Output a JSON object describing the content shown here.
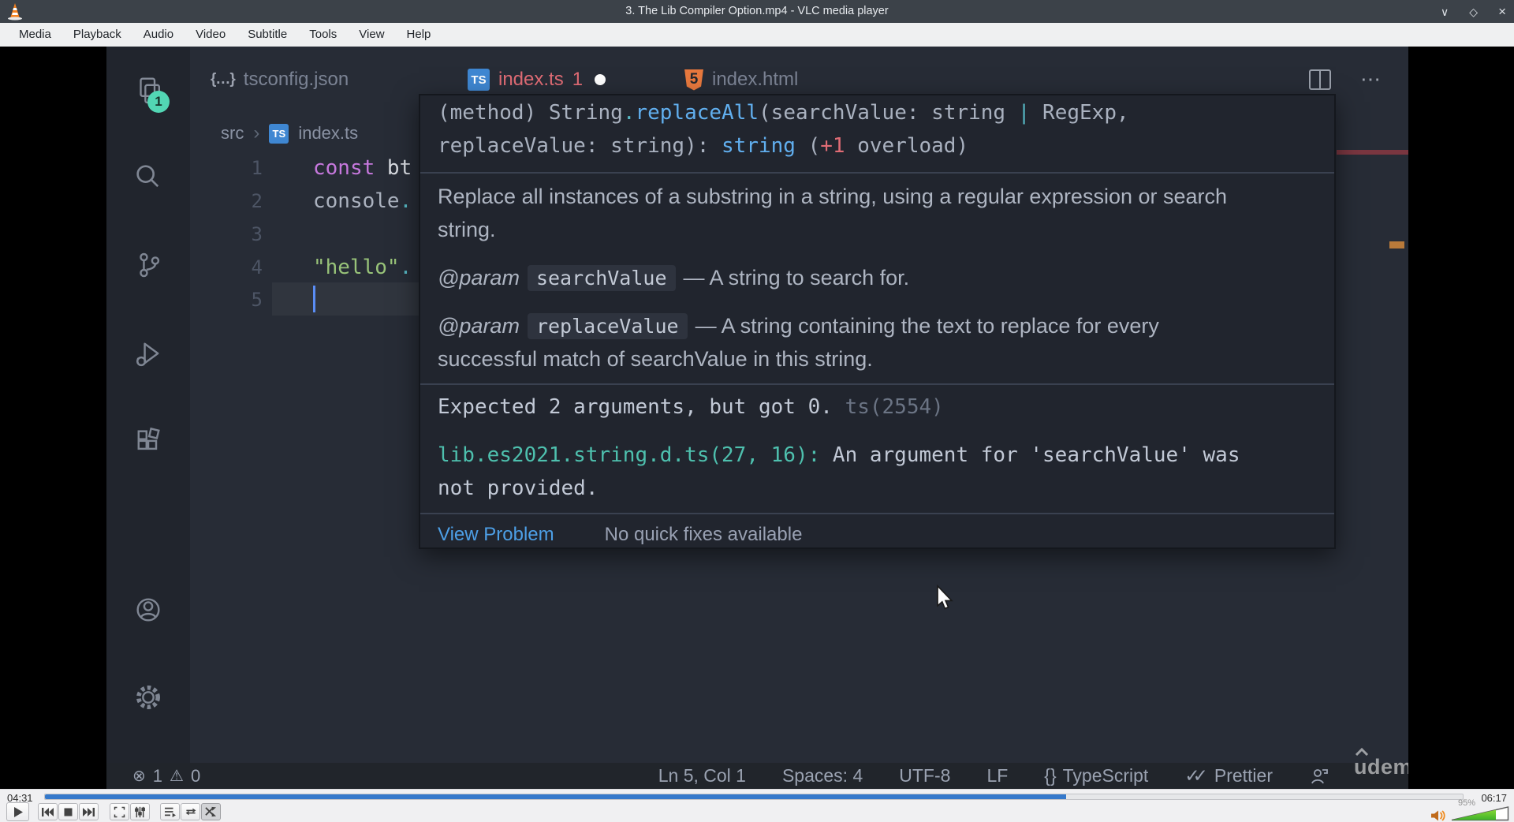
{
  "colors": {
    "titlebar_bg": "#3c4249",
    "menubar_bg": "#eff0f1",
    "editor_bg": "#272c36",
    "activitybar_bg": "#21252d",
    "tooltip_bg": "#21252e",
    "statusbar_bg": "#21252b",
    "accent_blue": "#61afef",
    "cyan": "#56b6c2",
    "keyword_purple": "#c678dd",
    "string_green": "#98c379",
    "error_red": "#e06c75",
    "source_path_teal": "#4ec0ae",
    "explorer_badge_teal": "#52d6b4",
    "ts_icon_blue": "#3f87d2",
    "html_icon_orange": "#e8793e",
    "seek_blue": "#3579cb",
    "volume_green": "#5ec42e"
  },
  "titlebar": {
    "title": "3. The Lib Compiler Option.mp4 - VLC media player",
    "minimize": "∨",
    "maximize": "◇",
    "close": "×"
  },
  "menu": [
    "Media",
    "Playback",
    "Audio",
    "Video",
    "Subtitle",
    "Tools",
    "View",
    "Help"
  ],
  "activity": {
    "explorer_badge": "1"
  },
  "tabs": {
    "json_icon": "{…}",
    "tab1": "tsconfig.json",
    "ts_icon": "TS",
    "tab2": "index.ts",
    "tab2_badge": "1",
    "html_icon": "5",
    "tab3": "index.html",
    "more_actions": "⋯"
  },
  "breadcrumb": {
    "folder": "src",
    "sep": "›",
    "file_icon": "TS",
    "file": "index.ts"
  },
  "code": {
    "line_numbers": [
      "1",
      "2",
      "3",
      "4",
      "5"
    ],
    "l1_keyword": "const",
    "l1_text": " bt",
    "l2_text": "console",
    "l2_accent": ".",
    "l4_string": "\"hello\"",
    "l4_accent": "."
  },
  "hover": {
    "sig1_pre": "(method) String",
    "sig1_dot": ".",
    "sig1_method": "replaceAll",
    "sig1_mid": "(searchValue: string ",
    "sig1_pipe": "|",
    "sig1_end": " RegExp,",
    "sig2_pre": "replaceValue: string): ",
    "sig2_type": "string",
    "sig2_mid": " (",
    "sig2_overload_num": "+1",
    "sig2_end": " overload)",
    "description_l1": "Replace all instances of a substring in a string, using a regular expression or search",
    "description_l2": "string.",
    "param1_tag": "@param",
    "param1_name": "searchValue",
    "param1_desc": "— A string to search for.",
    "param2_tag": "@param",
    "param2_name": "replaceValue",
    "param2_desc_l1": "— A string containing the text to replace for every",
    "param2_desc_l2": "successful match of searchValue in this string.",
    "error_msg": "Expected 2 arguments, but got 0.",
    "error_code": "ts(2554)",
    "source_path": "lib.es2021.string.d.ts(27, 16):",
    "source_text_l1": " An argument for 'searchValue' was",
    "source_text_l2": "not provided.",
    "footer_link": "View Problem",
    "footer_note": "No quick fixes available"
  },
  "status": {
    "errors": "1",
    "warnings": "0",
    "cursor": "Ln 5, Col 1",
    "indent": "Spaces: 4",
    "encoding": "UTF-8",
    "eol": "LF",
    "lang_icon": "{}",
    "language": "TypeScript",
    "formatter": "Prettier"
  },
  "watermark": "udemy",
  "transport": {
    "elapsed": "04:31",
    "total": "06:17",
    "progress_pct": 72,
    "volume_label": "95%",
    "volume_fill_pct": 77
  }
}
